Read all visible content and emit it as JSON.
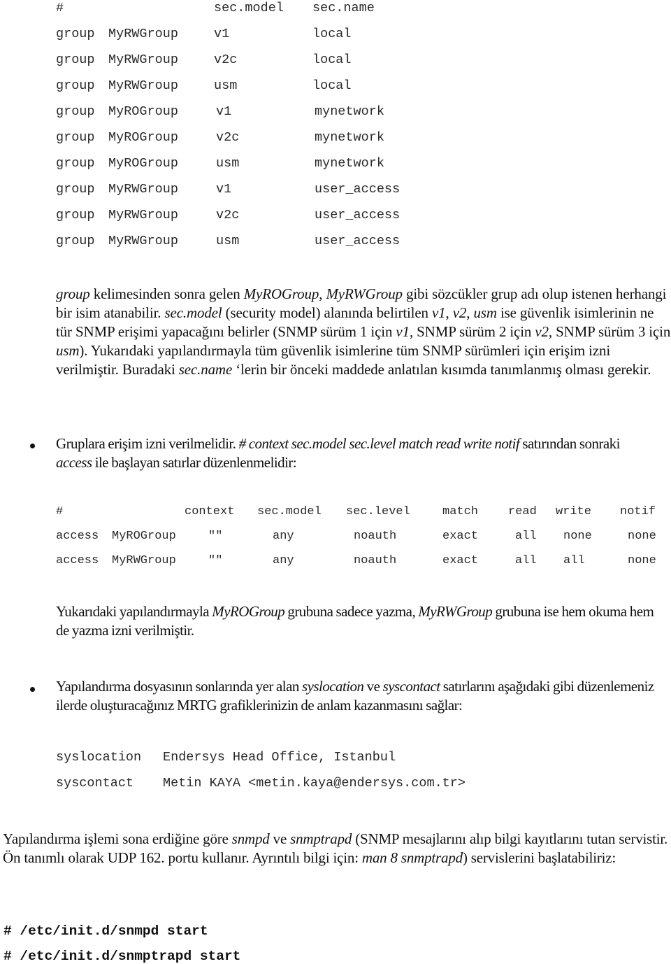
{
  "group_table": {
    "header": [
      "#",
      "",
      "sec.model",
      "sec.name"
    ],
    "rows": [
      [
        "group",
        "MyRWGroup",
        "v1",
        "local"
      ],
      [
        "group",
        "MyRWGroup",
        "v2c",
        "local"
      ],
      [
        "group",
        "MyRWGroup",
        "usm",
        "local"
      ],
      [
        "group",
        "MyROGroup",
        "v1",
        "mynetwork"
      ],
      [
        "group",
        "MyROGroup",
        "v2c",
        "mynetwork"
      ],
      [
        "group",
        "MyROGroup",
        "usm",
        "mynetwork"
      ],
      [
        "group",
        "MyRWGroup",
        "v1",
        "user_access"
      ],
      [
        "group",
        "MyRWGroup",
        "v2c",
        "user_access"
      ],
      [
        "group",
        "MyRWGroup",
        "usm",
        "user_access"
      ]
    ]
  },
  "paragraph1": {
    "parts": [
      {
        "t": "group",
        "i": true
      },
      {
        "t": " kelimesinden sonra gelen ",
        "i": false
      },
      {
        "t": "MyROGroup",
        "i": true
      },
      {
        "t": ", ",
        "i": false
      },
      {
        "t": "MyRWGroup",
        "i": true
      },
      {
        "t": " gibi sözcükler grup adı olup istenen herhangi bir isim atanabilir. ",
        "i": false
      },
      {
        "t": "sec.model",
        "i": true
      },
      {
        "t": " (security model) alanında belirtilen ",
        "i": false
      },
      {
        "t": "v1",
        "i": true
      },
      {
        "t": ", ",
        "i": false
      },
      {
        "t": "v2",
        "i": true
      },
      {
        "t": ", ",
        "i": false
      },
      {
        "t": "usm",
        "i": true
      },
      {
        "t": " ise güvenlik isimlerinin ne tür SNMP erişimi yapacağını belirler (SNMP sürüm 1 için ",
        "i": false
      },
      {
        "t": "v1",
        "i": true
      },
      {
        "t": ", SNMP sürüm 2 için ",
        "i": false
      },
      {
        "t": "v2",
        "i": true
      },
      {
        "t": ", SNMP sürüm 3 için ",
        "i": false
      },
      {
        "t": "usm",
        "i": true
      },
      {
        "t": "). Yukarıdaki yapılandırmayla tüm güvenlik isimlerine tüm SNMP sürümleri için erişim izni verilmiştir.  Buradaki ",
        "i": false
      },
      {
        "t": "sec.name",
        "i": true
      },
      {
        "t": " ‘lerin bir önceki maddede anlatılan kısımda tanımlanmış olması gerekir.",
        "i": false
      }
    ]
  },
  "bullet1": {
    "parts": [
      {
        "t": "Gruplara erişim izni verilmelidir. ",
        "i": false
      },
      {
        "t": "# context sec.model sec.level match  read  write  notif",
        "i": true
      },
      {
        "t": " satırından sonraki ",
        "i": false
      },
      {
        "t": "access",
        "i": true
      },
      {
        "t": " ile başlayan satırlar düzenlenmelidir:",
        "i": false
      }
    ]
  },
  "access_table": {
    "header": [
      "#",
      "",
      "context",
      "sec.model",
      "sec.level",
      "match",
      "read",
      "write",
      "notif"
    ],
    "rows": [
      [
        "access",
        "MyROGroup",
        "\"\"",
        "any",
        "noauth",
        "exact",
        "all",
        "none",
        "none"
      ],
      [
        "access",
        "MyRWGroup",
        "\"\"",
        "any",
        "noauth",
        "exact",
        "all",
        "all",
        "none"
      ]
    ]
  },
  "paragraph2": {
    "parts": [
      {
        "t": "Yukarıdaki yapılandırmayla ",
        "i": false
      },
      {
        "t": "MyROGroup",
        "i": true
      },
      {
        "t": " grubuna sadece yazma, ",
        "i": false
      },
      {
        "t": "MyRWGroup",
        "i": true
      },
      {
        "t": " grubuna ise hem okuma hem de yazma izni verilmiştir.",
        "i": false
      }
    ]
  },
  "bullet2": {
    "parts": [
      {
        "t": "Yapılandırma dosyasının sonlarında yer alan ",
        "i": false
      },
      {
        "t": "syslocation",
        "i": true
      },
      {
        "t": " ve ",
        "i": false
      },
      {
        "t": "syscontact",
        "i": true
      },
      {
        "t": " satırlarını aşağıdaki gibi düzenlemeniz ilerde oluşturacağınız MRTG grafiklerinizin de anlam kazanmasını sağlar:",
        "i": false
      }
    ]
  },
  "sys_config": [
    {
      "key": "syslocation",
      "value": "Endersys Head Office, Istanbul"
    },
    {
      "key": "syscontact",
      "value": "Metin KAYA <metin.kaya@endersys.com.tr>"
    }
  ],
  "paragraph3": {
    "parts": [
      {
        "t": "Yapılandırma işlemi sona erdiğine göre ",
        "i": false
      },
      {
        "t": "snmpd",
        "i": true
      },
      {
        "t": " ve ",
        "i": false
      },
      {
        "t": "snmptrapd",
        "i": true
      },
      {
        "t": " (SNMP mesajlarını alıp bilgi kayıtlarını tutan servistir. Ön tanımlı olarak UDP 162. portu kullanır. Ayrıntılı bilgi için: ",
        "i": false
      },
      {
        "t": "man 8 snmptrapd",
        "i": true
      },
      {
        "t": ") servislerini başlatabiliriz:",
        "i": false
      }
    ]
  },
  "commands": [
    "# /etc/init.d/snmpd start",
    "# /etc/init.d/snmptrapd start"
  ]
}
